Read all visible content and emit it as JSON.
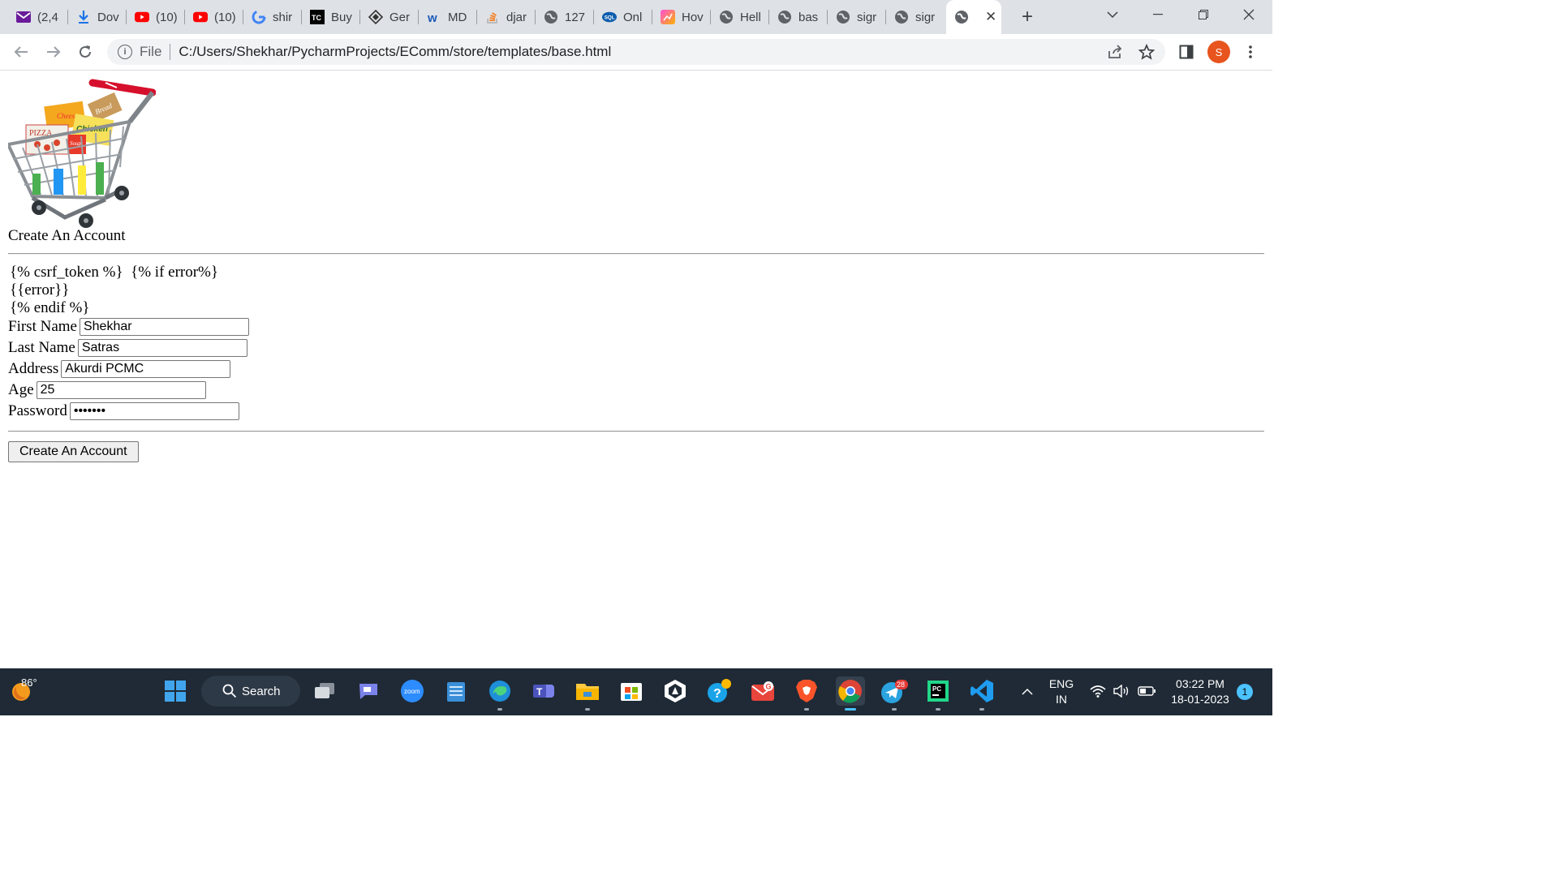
{
  "browser": {
    "tabs": [
      {
        "title": "(2,4",
        "icon": "mail-icon"
      },
      {
        "title": "Dov",
        "icon": "download-icon"
      },
      {
        "title": "(10)",
        "icon": "youtube-icon"
      },
      {
        "title": "(10)",
        "icon": "youtube-icon"
      },
      {
        "title": "shir",
        "icon": "google-icon"
      },
      {
        "title": "Buy",
        "icon": "tc-icon"
      },
      {
        "title": "Ger",
        "icon": "diamond-icon"
      },
      {
        "title": "MD",
        "icon": "w-icon"
      },
      {
        "title": "djar",
        "icon": "stackoverflow-icon"
      },
      {
        "title": "127",
        "icon": "globe-icon"
      },
      {
        "title": "Onl",
        "icon": "sql-icon"
      },
      {
        "title": "Hov",
        "icon": "gradient-icon"
      },
      {
        "title": "Hell",
        "icon": "globe-icon"
      },
      {
        "title": "bas",
        "icon": "globe-icon"
      },
      {
        "title": "sigr",
        "icon": "globe-icon"
      },
      {
        "title": "sigr",
        "icon": "globe-icon"
      }
    ],
    "active_tab_icon": "globe-icon",
    "address": {
      "scheme_label": "File",
      "url": "C:/Users/Shekhar/PycharmProjects/EComm/store/templates/base.html"
    },
    "profile_initial": "S"
  },
  "page": {
    "heading": "Create An Account",
    "template_lines": [
      "{% csrf_token %}  {% if error%}",
      "{{error}}",
      "{% endif %}"
    ],
    "fields": [
      {
        "label": "First Name",
        "value": "Shekhar"
      },
      {
        "label": "Last Name",
        "value": "Satras"
      },
      {
        "label": "Address",
        "value": "Akurdi PCMC"
      },
      {
        "label": "Age",
        "value": "25"
      },
      {
        "label": "Password",
        "value": "•••••••"
      }
    ],
    "submit_label": "Create An Account",
    "cart_labels": {
      "box1": "Bread",
      "box2": "Chicken",
      "box3": "PIZZA",
      "box4": "Cheese",
      "can": "Soup"
    }
  },
  "taskbar": {
    "weather": "86°",
    "search_label": "Search",
    "zoom_label": "zoom",
    "telegram_badge": "28",
    "language": [
      "ENG",
      "IN"
    ],
    "time": "03:22 PM",
    "date": "18-01-2023",
    "notification_count": "1"
  },
  "colors": {
    "tabstrip": "#dee1e6",
    "taskbar": "#1f2a36",
    "profile": "#e8541d"
  }
}
